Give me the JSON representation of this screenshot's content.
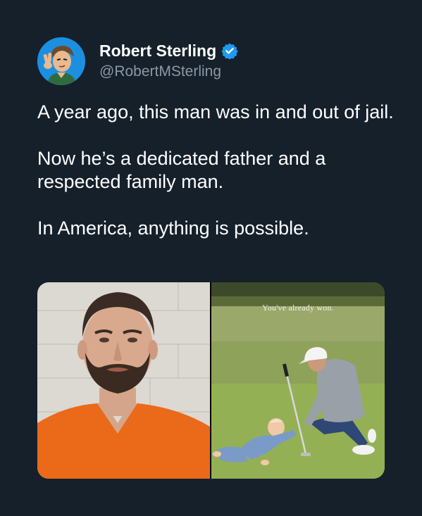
{
  "author": {
    "display_name": "Robert Sterling",
    "handle": "@RobertMSterling",
    "avatar_icon": "cartoon-avatar-icon",
    "verified_icon": "verified-badge-icon",
    "verified_color": "#1d9bf0"
  },
  "tweet": {
    "paragraphs": [
      "A year ago, this man was in and out of jail.",
      "Now he’s a dedicated father and a respected family man.",
      "In America, anything is possible."
    ]
  },
  "media": {
    "right_caption": "You've already won."
  },
  "colors": {
    "background": "#15202b",
    "text": "#ffffff",
    "secondary_text": "#8b98a5"
  }
}
